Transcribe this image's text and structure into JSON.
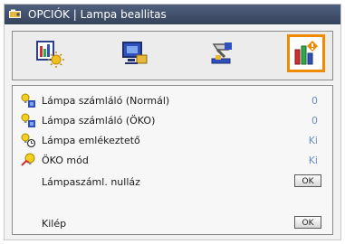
{
  "window": {
    "title": "OPCIÓK | Lampa beallitas"
  },
  "tabs": [
    {
      "name": "image-settings",
      "icon": "image-sun-icon"
    },
    {
      "name": "display-settings",
      "icon": "display-monitor-icon"
    },
    {
      "name": "setup-settings",
      "icon": "setup-tools-icon"
    },
    {
      "name": "options-settings",
      "icon": "options-bars-icon",
      "active": true
    }
  ],
  "menu": {
    "lamp_hours_normal": {
      "label": "Lámpa számláló (Normál)",
      "value": "0"
    },
    "lamp_hours_eco": {
      "label": "Lámpa számláló (ÖKO)",
      "value": "0"
    },
    "lamp_reminder": {
      "label": "Lámpa emlékeztető",
      "value": "Ki"
    },
    "eco_mode": {
      "label": "ÖKO mód",
      "value": "Ki"
    },
    "lamp_reset": {
      "label": "Lámpaszáml. nulláz",
      "button": "OK"
    },
    "exit": {
      "label": "Kilép",
      "button": "OK"
    }
  },
  "colors": {
    "accent": "#f08a00",
    "value_text": "#6e8fc4",
    "title_bar": "#3f4c67"
  }
}
